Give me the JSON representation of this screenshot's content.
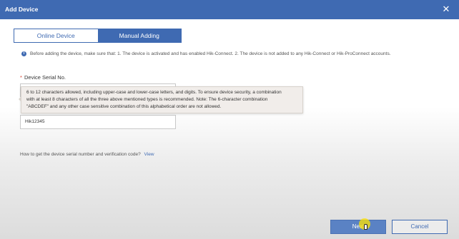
{
  "window": {
    "title": "Add Device",
    "close_icon": "close-icon"
  },
  "tabs": [
    {
      "label": "Online Device",
      "active": false
    },
    {
      "label": "Manual Adding",
      "active": true
    }
  ],
  "notice": {
    "icon": "info-icon",
    "text": "Before adding the device, make sure that: 1. The device is activated and has enabled Hik-Connect. 2. The device is not added to any Hik-Connect or Hik-ProConnect accounts."
  },
  "form": {
    "serial": {
      "required_mark": "*",
      "label": "Device Serial No.",
      "value": ""
    },
    "verification": {
      "required_mark": "*",
      "value": "Hik12345"
    }
  },
  "tooltip": {
    "line1": "6 to 12 characters allowed, including upper-case and lower-case letters, and digits. To ensure device security, a combination",
    "line2": "with at least 8 characters of all the three above mentioned types is recommended. Note: The 6-character combination",
    "line3": "\"ABCDEF\" and any other case sensitive combination of this alphabetical order are not allowed."
  },
  "help": {
    "text": "How to get the device serial number and verification code?",
    "link": "View"
  },
  "buttons": {
    "next": "Next",
    "cancel": "Cancel"
  },
  "colors": {
    "primary": "#3f6ab2",
    "required": "#d9412f"
  }
}
